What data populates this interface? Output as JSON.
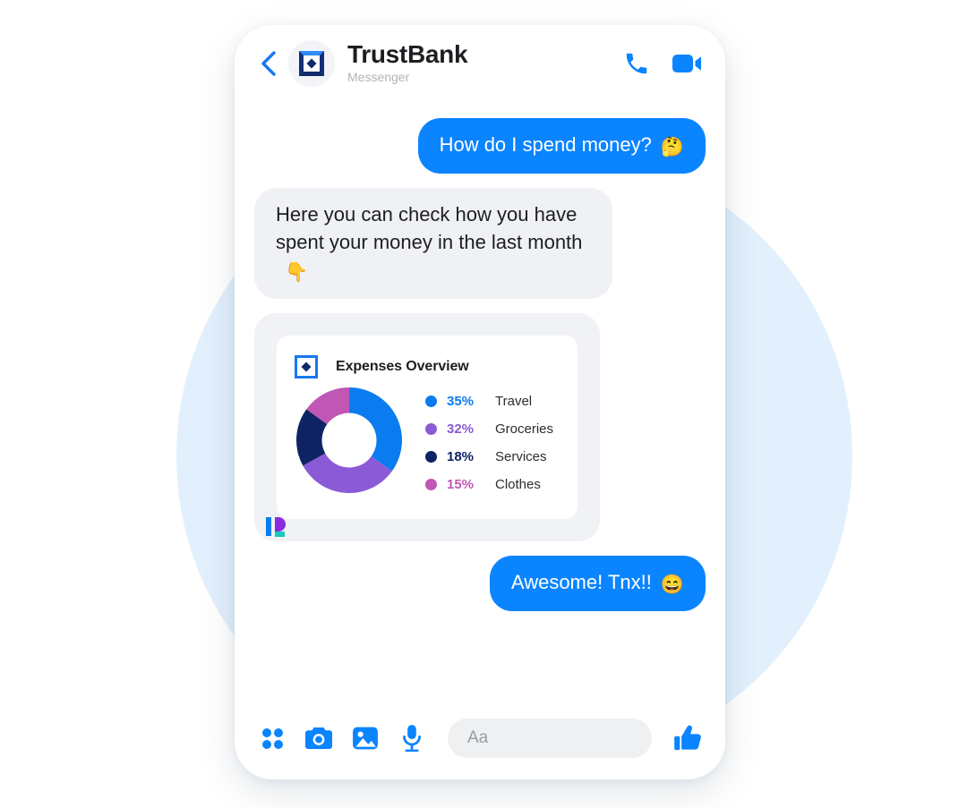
{
  "background": {
    "blob_color": "#e2f0fd"
  },
  "header": {
    "back_icon": "chevron-left-icon",
    "avatar_icon": "trustbank-logo-icon",
    "title": "TrustBank",
    "subtitle": "Messenger",
    "call_icon": "phone-icon",
    "video_icon": "video-camera-icon"
  },
  "messages": [
    {
      "direction": "out",
      "text": "How do I spend money?",
      "emoji": "🤔",
      "emoji_name": "thinking-face-emoji"
    },
    {
      "direction": "in",
      "text": "Here you can check how you have spent your money in the last month",
      "emoji": "👇",
      "emoji_name": "backhand-index-pointing-down-emoji"
    },
    {
      "direction": "out",
      "text": "Awesome! Tnx!!",
      "emoji": "😄",
      "emoji_name": "grinning-face-with-smiling-eyes-emoji"
    }
  ],
  "expense_card": {
    "icon": "trustbank-square-diamond-icon",
    "title": "Expenses Overview",
    "brand_mark": "partner-p-logo-icon"
  },
  "chart_data": {
    "type": "pie",
    "title": "Expenses Overview",
    "subtype": "donut",
    "legend_position": "right",
    "start_angle_deg": 0,
    "direction": "clockwise",
    "inner_radius_ratio": 0.52,
    "categories": [
      "Travel",
      "Groceries",
      "Services",
      "Clothes"
    ],
    "values": [
      35,
      32,
      18,
      15
    ],
    "unit": "%",
    "colors": [
      "#0a7cf0",
      "#8b5ad6",
      "#0d2364",
      "#c057b4"
    ],
    "labels": [
      "35%",
      "32%",
      "18%",
      "15%"
    ],
    "slices": [
      {
        "label": "Travel",
        "value": 35,
        "display": "35%",
        "color": "#0a7cf0"
      },
      {
        "label": "Groceries",
        "value": 32,
        "display": "32%",
        "color": "#8b5ad6"
      },
      {
        "label": "Services",
        "value": 18,
        "display": "18%",
        "color": "#0d2364"
      },
      {
        "label": "Clothes",
        "value": 15,
        "display": "15%",
        "color": "#c057b4"
      }
    ]
  },
  "composer": {
    "menu_icon": "four-dots-grid-icon",
    "camera_icon": "camera-icon",
    "gallery_icon": "image-icon",
    "mic_icon": "microphone-icon",
    "input_placeholder": "Aa",
    "input_value": "",
    "like_icon": "thumbs-up-icon"
  },
  "colors": {
    "accent": "#0a84ff",
    "bubble_in": "#f0f1f4",
    "card_outer": "#f1f2f5"
  }
}
